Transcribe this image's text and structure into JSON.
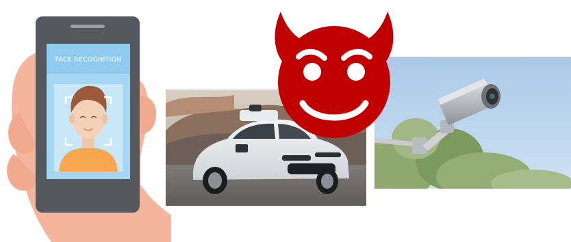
{
  "phone": {
    "screen_title": "FACE RECOGNITION"
  },
  "icons": {
    "phone": "phone-face-recognition-illustration",
    "car": "self-driving-car-photo",
    "camera": "security-camera-photo",
    "devil": "devil-face-emoji"
  },
  "colors": {
    "devil_red": "#C00000",
    "phone_body": "#55595E",
    "screen_blue": "#9FD3F0",
    "shirt_orange": "#F7A84E",
    "hand_skin": "#F4B49A",
    "sky_blue": "#B7D5EE"
  }
}
